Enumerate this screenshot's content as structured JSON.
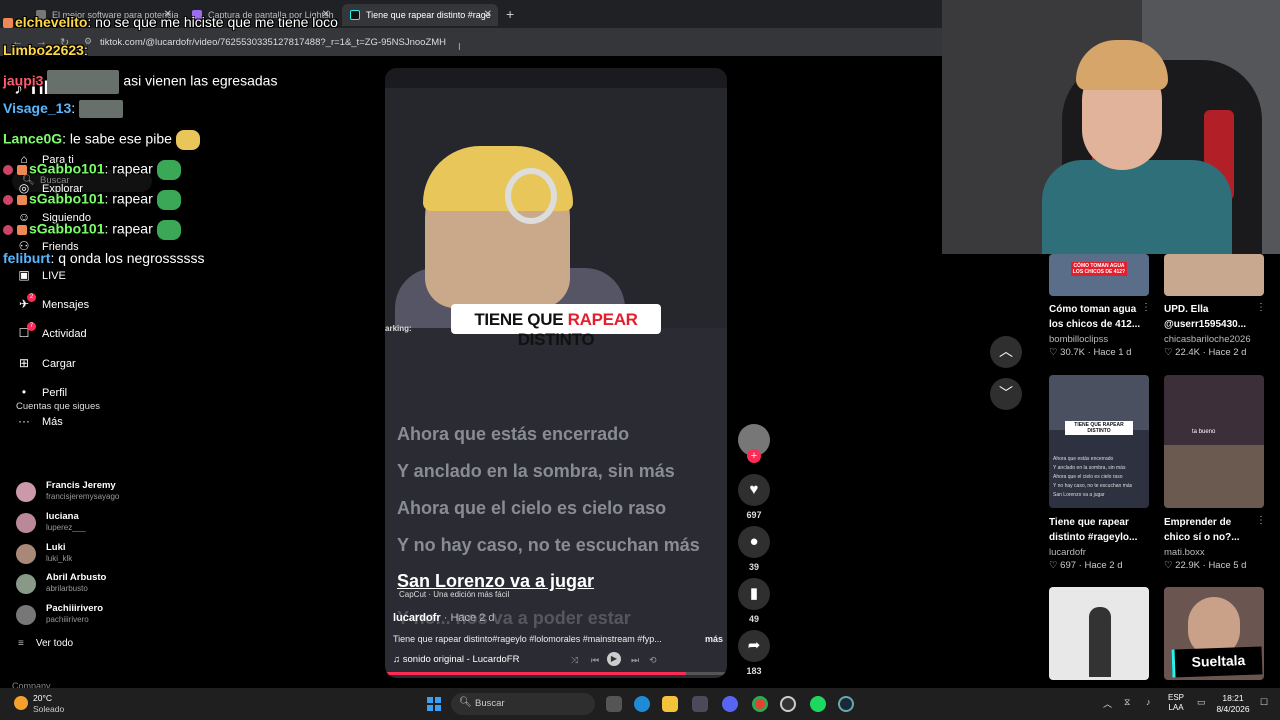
{
  "browser": {
    "tabs": [
      {
        "title": "El mejor software para potencia"
      },
      {
        "title": "Captura de pantalla por Lightsh"
      },
      {
        "title": "Tiene que rapear distinto #rage"
      }
    ],
    "url": "tiktok.com/@lucardofr/video/7625530335127817488?_r=1&_t=ZG-95NSJnooZMH"
  },
  "sidebar": {
    "search_placeholder": "Buscar",
    "nav": [
      {
        "label": "Para ti",
        "icon": "home-icon"
      },
      {
        "label": "Explorar",
        "icon": "compass-icon"
      },
      {
        "label": "Siguiendo",
        "icon": "following-icon"
      },
      {
        "label": "Friends",
        "icon": "friends-icon"
      },
      {
        "label": "LIVE",
        "icon": "live-icon"
      },
      {
        "label": "Mensajes",
        "icon": "messages-icon",
        "badge": "2"
      },
      {
        "label": "Actividad",
        "icon": "activity-icon",
        "badge": "7"
      },
      {
        "label": "Cargar",
        "icon": "upload-icon"
      },
      {
        "label": "Perfil",
        "icon": "profile-icon"
      },
      {
        "label": "Más",
        "icon": "more-icon"
      }
    ],
    "following_title": "Cuentas que sigues",
    "accounts": [
      {
        "name": "Francis Jeremy",
        "handle": "francisjeremysayago"
      },
      {
        "name": "luciana",
        "handle": "luperez___"
      },
      {
        "name": "Luki",
        "handle": "luki_klk"
      },
      {
        "name": "Abril Arbusto",
        "handle": "abrilarbusto"
      },
      {
        "name": "Pachiiirivero",
        "handle": "pachiiirivero"
      }
    ],
    "see_all": "Ver todo",
    "company": "Company"
  },
  "chat": [
    {
      "user": "elchevelito",
      "color": "#ffd84a",
      "text": ": no se que me hiciste que me tiene loco"
    },
    {
      "user": "Limbo22623",
      "color": "#ffd84a",
      "text": ":"
    },
    {
      "user": "jaupi3",
      "color": "#ff5a6e",
      "text": " asi vienen las egresadas"
    },
    {
      "user": "Visage_13",
      "color": "#59b7ff",
      "text": ":"
    },
    {
      "user": "Lance0G",
      "color": "#7dff6a",
      "text": ": le sabe ese pibe"
    },
    {
      "user": "sGabbo101",
      "color": "#7dff6a",
      "text": ": rapear"
    },
    {
      "user": "sGabbo101",
      "color": "#7dff6a",
      "text": ": rapear"
    },
    {
      "user": "sGabbo101",
      "color": "#7dff6a",
      "text": ": rapear"
    },
    {
      "user": "feliburt",
      "color": "#59b7ff",
      "text": ": q onda los negrossssss"
    }
  ],
  "video": {
    "caption": {
      "pre": "TIENE QUE ",
      "red": "RAPEAR",
      "post": " DISTINTO"
    },
    "parking": "arking:",
    "lyrics": [
      "Ahora que estás encerrado",
      "Y anclado en la sombra, sin más",
      "Ahora que el cielo es cielo raso",
      "Y no hay caso, no te escuchan más",
      "San Lorenzo va a jugar",
      "Y no... nos va a poder estar"
    ],
    "current_lyric_index": 4,
    "capcut": "CapCut · Una edición más fácil",
    "author": "lucardofr",
    "ago": " · Hace 2 d",
    "description": "Tiene que rapear distinto#rageylo #lolomorales #mainstream #fyp...",
    "more": "más",
    "sound": "sonido original - LucardoFR",
    "progress": 0.88
  },
  "actions": {
    "likes": "697",
    "comments": "39",
    "saves": "49",
    "shares": "183"
  },
  "feed": [
    {
      "title1": "Cómo toman agua",
      "title2": "los chicos de 412...",
      "user": "bombilloclipss",
      "views": "30.7K",
      "ago": "Hace 1 d",
      "thumb_text": "CÓMO TOMAN AGUA LOS CHICOS DE 412?"
    },
    {
      "title1": "UPD. Ella",
      "title2": "@userr1595430...",
      "user": "chicasbariloche2026",
      "views": "22.4K",
      "ago": "Hace 2 d"
    },
    {
      "title1": "Tiene que rapear",
      "title2": "distinto #rageylo...",
      "user": "lucardofr",
      "views": "697",
      "ago": "Hace 2 d",
      "thumb_text": "TIENE QUE RAPEAR DISTINTO"
    },
    {
      "title1": "Emprender de",
      "title2": "chico sí o no?...",
      "user": "mati.boxx",
      "views": "22.9K",
      "ago": "Hace 5 d",
      "thumb_text": "ta bueno"
    },
    {
      "badge": "Sueltala"
    }
  ],
  "taskbar": {
    "temp": "20°C",
    "weather": "Soleado",
    "search": "Buscar",
    "lang1": "ESP",
    "lang2": "LAA",
    "time": "18:21",
    "date": "8/4/2026"
  }
}
